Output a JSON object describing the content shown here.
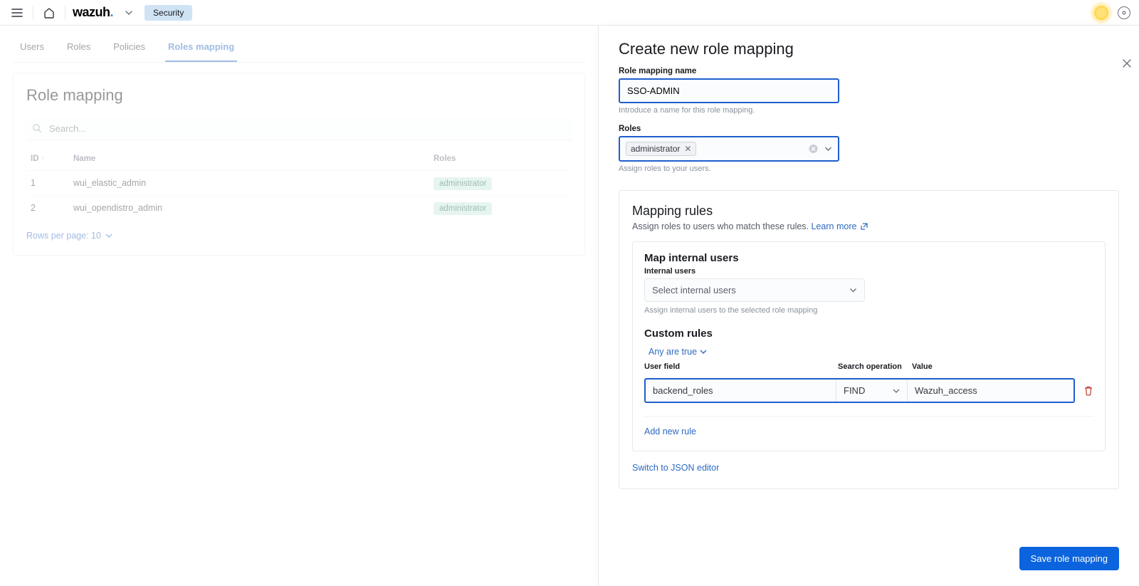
{
  "header": {
    "breadcrumb": "Security"
  },
  "tabs": [
    "Users",
    "Roles",
    "Policies",
    "Roles mapping"
  ],
  "active_tab": 3,
  "panel": {
    "title": "Role mapping",
    "search_placeholder": "Search...",
    "columns": {
      "id": "ID",
      "name": "Name",
      "roles": "Roles"
    },
    "rows": [
      {
        "id": "1",
        "name": "wui_elastic_admin",
        "role": "administrator"
      },
      {
        "id": "2",
        "name": "wui_opendistro_admin",
        "role": "administrator"
      }
    ],
    "rows_per_page": "Rows per page: 10"
  },
  "flyout": {
    "title": "Create new role mapping",
    "name_label": "Role mapping name",
    "name_value": "SSO-ADMIN",
    "name_help": "Introduce a name for this role mapping.",
    "roles_label": "Roles",
    "roles_selected": "administrator",
    "roles_help": "Assign roles to your users.",
    "mapping_title": "Mapping rules",
    "mapping_sub_prefix": "Assign roles to users who match these rules. ",
    "mapping_learn": "Learn more",
    "map_internal_title": "Map internal users",
    "internal_label": "Internal users",
    "internal_placeholder": "Select internal users",
    "internal_help": "Assign internal users to the selected role mapping",
    "custom_rules_title": "Custom rules",
    "any_true": "Any are true",
    "rule_labels": {
      "user_field": "User field",
      "search_op": "Search operation",
      "value": "Value"
    },
    "rule": {
      "user_field": "backend_roles",
      "search_op": "FIND",
      "value": "Wazuh_access"
    },
    "add_rule": "Add new rule",
    "switch_json": "Switch to JSON editor",
    "save": "Save role mapping"
  }
}
